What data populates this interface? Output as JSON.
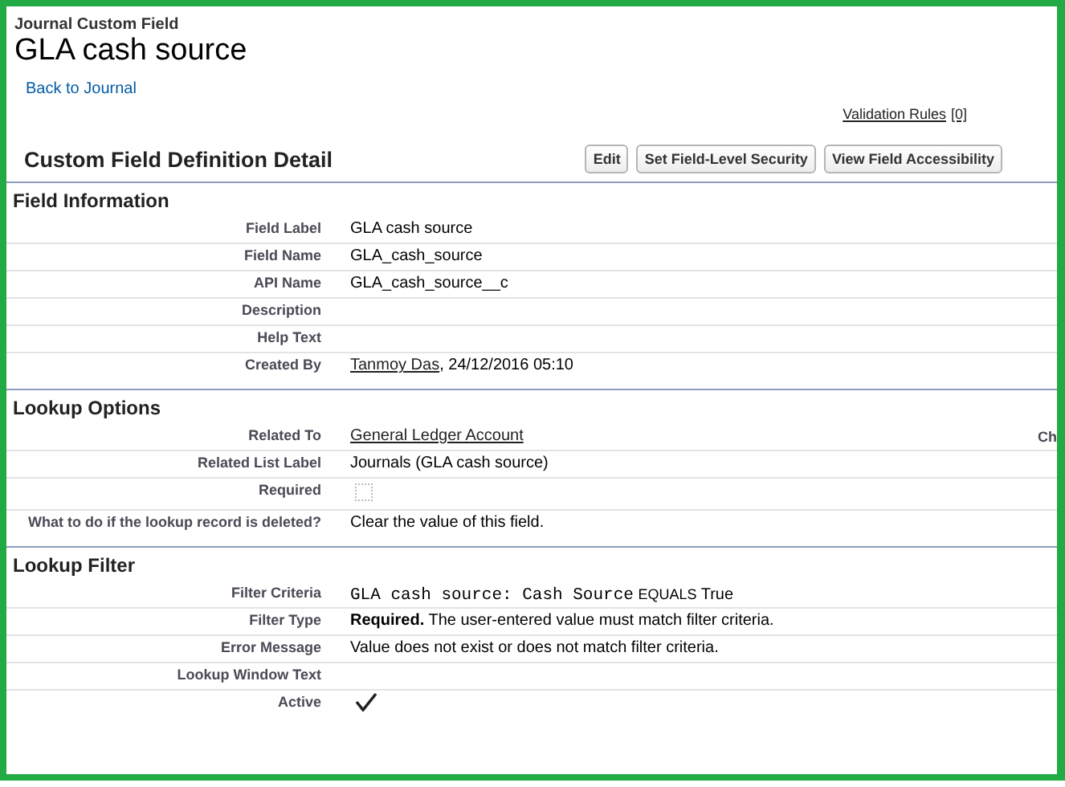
{
  "header": {
    "object_type": "Journal Custom Field",
    "title": "GLA cash source",
    "back_link": "Back to Journal",
    "validation_rules": {
      "label": "Validation Rules",
      "count": "[0]"
    }
  },
  "detail": {
    "title": "Custom Field Definition Detail",
    "buttons": [
      "Edit",
      "Set Field-Level Security",
      "View Field Accessibility"
    ]
  },
  "sections": [
    {
      "title": "Field Information",
      "rows": [
        {
          "label": "Field Label",
          "kind": "text",
          "value": "GLA cash source"
        },
        {
          "label": "Field Name",
          "kind": "text",
          "value": "GLA_cash_source"
        },
        {
          "label": "API Name",
          "kind": "text",
          "value": "GLA_cash_source__c"
        },
        {
          "label": "Description",
          "kind": "text"
        },
        {
          "label": "Help Text",
          "kind": "text"
        },
        {
          "label": "Created By",
          "kind": "link",
          "link": "Tanmoy Das",
          "suffix": ", 24/12/2016 05:10"
        }
      ]
    },
    {
      "title": "Lookup Options",
      "rows": [
        {
          "label": "Related To",
          "kind": "link",
          "link": "General Ledger Account",
          "column_3": "Ch"
        },
        {
          "label": "Related List Label",
          "kind": "text",
          "value": "Journals (GLA cash source)"
        },
        {
          "label": "Required",
          "kind": "checkbox",
          "checked": false
        },
        {
          "label": "What to do if the lookup record is deleted?",
          "kind": "text",
          "value": "Clear the value of this field."
        }
      ]
    },
    {
      "title": "Lookup Filter",
      "rows": [
        {
          "label": "Filter Criteria",
          "kind": "filter",
          "field": "GLA cash source: Cash Source",
          "operator": "EQUALS",
          "value": "True"
        },
        {
          "label": "Filter Type",
          "kind": "rich",
          "value": "**Required.** The user-entered value must match filter criteria."
        },
        {
          "label": "Error Message",
          "kind": "text",
          "value": "Value does not exist or does not match filter criteria."
        },
        {
          "label": "Lookup Window Text",
          "kind": "text"
        },
        {
          "label": "Active",
          "kind": "checkbox",
          "checked": true
        }
      ]
    }
  ]
}
